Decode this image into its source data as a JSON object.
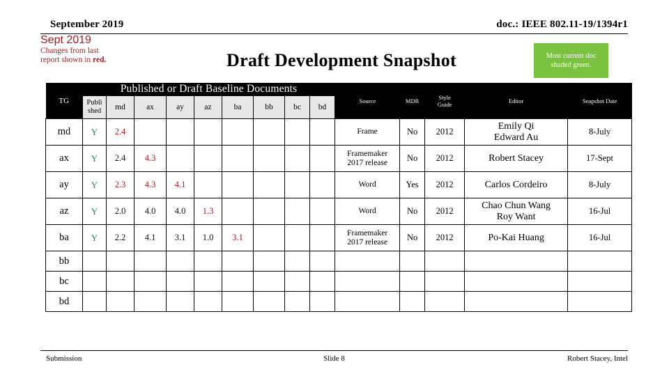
{
  "header": {
    "date": "September 2019",
    "doc": "doc.: IEEE 802.11-19/1394r1"
  },
  "change_note": {
    "title": "Sept 2019",
    "line1": "Changes from  last",
    "line2_prefix": "report shown in ",
    "line2_emphasis": "red."
  },
  "title": "Draft Development Snapshot",
  "legend": {
    "line1": "Most current doc",
    "line2": "shaded green.",
    "color": "#7cc241"
  },
  "table": {
    "tg_header": "TG",
    "group_header": "Published or Draft Baseline Documents",
    "right_headers": {
      "source": "Source",
      "mdr": "MDR",
      "style_guide_line1": "Style",
      "style_guide_line2": "Guide",
      "editor": "Editor",
      "snapshot_date": "Snapshot Date"
    },
    "sub_headers": {
      "published_line1": "Publi",
      "published_line2": "shed",
      "md": "md",
      "ax": "ax",
      "ay": "ay",
      "az": "az",
      "ba": "ba",
      "bb": "bb",
      "bc": "bc",
      "bd": "bd"
    },
    "rows": [
      {
        "tg": "md",
        "published": "Y",
        "md": "2.4",
        "md_new": true,
        "ax": "",
        "ax_new": false,
        "ay": "",
        "ay_new": false,
        "az": "",
        "az_new": false,
        "ba": "",
        "ba_new": false,
        "bb": "",
        "bc": "",
        "bd": "",
        "source_line1": "Frame",
        "source_line2": "",
        "mdr": "No",
        "style_guide": "2012",
        "editor_line1": "Emily Qi",
        "editor_line2": "Edward Au",
        "snapshot_date": "8-July"
      },
      {
        "tg": "ax",
        "published": "Y",
        "md": "2.4",
        "md_new": false,
        "ax": "4.3",
        "ax_new": true,
        "ay": "",
        "ay_new": false,
        "az": "",
        "az_new": false,
        "ba": "",
        "ba_new": false,
        "bb": "",
        "bc": "",
        "bd": "",
        "source_line1": "Framemaker",
        "source_line2": "2017 release",
        "mdr": "No",
        "style_guide": "2012",
        "editor_line1": "Robert Stacey",
        "editor_line2": "",
        "snapshot_date": "17-Sept"
      },
      {
        "tg": "ay",
        "published": "Y",
        "md": "2.3",
        "md_new": true,
        "ax": "4.3",
        "ax_new": true,
        "ay": "4.1",
        "ay_new": true,
        "az": "",
        "az_new": false,
        "ba": "",
        "ba_new": false,
        "bb": "",
        "bc": "",
        "bd": "",
        "source_line1": "Word",
        "source_line2": "",
        "mdr": "Yes",
        "style_guide": "2012",
        "editor_line1": "Carlos Cordeiro",
        "editor_line2": "",
        "snapshot_date": "8-July"
      },
      {
        "tg": "az",
        "published": "Y",
        "md": "2.0",
        "md_new": false,
        "ax": "4.0",
        "ax_new": false,
        "ay": "4.0",
        "ay_new": false,
        "az": "1.3",
        "az_new": true,
        "ba": "",
        "ba_new": false,
        "bb": "",
        "bc": "",
        "bd": "",
        "source_line1": "Word",
        "source_line2": "",
        "mdr": "No",
        "style_guide": "2012",
        "editor_line1": "Chao Chun Wang",
        "editor_line2": "Roy Want",
        "snapshot_date": "16-Jul"
      },
      {
        "tg": "ba",
        "published": "Y",
        "md": "2.2",
        "md_new": false,
        "ax": "4.1",
        "ax_new": false,
        "ay": "3.1",
        "ay_new": false,
        "az": "1.0",
        "az_new": false,
        "ba": "3.1",
        "ba_new": true,
        "bb": "",
        "bc": "",
        "bd": "",
        "source_line1": "Framemaker",
        "source_line2": "2017 release",
        "mdr": "No",
        "style_guide": "2012",
        "editor_line1": "Po-Kai Huang",
        "editor_line2": "",
        "snapshot_date": "16-Jul"
      },
      {
        "tg": "bb",
        "published": "",
        "md": "",
        "ax": "",
        "ay": "",
        "az": "",
        "ba": "",
        "bb": "",
        "bc": "",
        "bd": "",
        "source_line1": "",
        "source_line2": "",
        "mdr": "",
        "style_guide": "",
        "editor_line1": "",
        "editor_line2": "",
        "snapshot_date": ""
      },
      {
        "tg": "bc",
        "published": "",
        "md": "",
        "ax": "",
        "ay": "",
        "az": "",
        "ba": "",
        "bb": "",
        "bc": "",
        "bd": "",
        "source_line1": "",
        "source_line2": "",
        "mdr": "",
        "style_guide": "",
        "editor_line1": "",
        "editor_line2": "",
        "snapshot_date": ""
      },
      {
        "tg": "bd",
        "published": "",
        "md": "",
        "ax": "",
        "ay": "",
        "az": "",
        "ba": "",
        "bb": "",
        "bc": "",
        "bd": "",
        "source_line1": "",
        "source_line2": "",
        "mdr": "",
        "style_guide": "",
        "editor_line1": "",
        "editor_line2": "",
        "snapshot_date": ""
      }
    ]
  },
  "footer": {
    "left": "Submission",
    "center": "Slide 8",
    "right": "Robert Stacey, Intel"
  },
  "colors": {
    "change_red": "#a81b20",
    "published_green": "#1f8a4c",
    "legend_green": "#7cc241"
  }
}
